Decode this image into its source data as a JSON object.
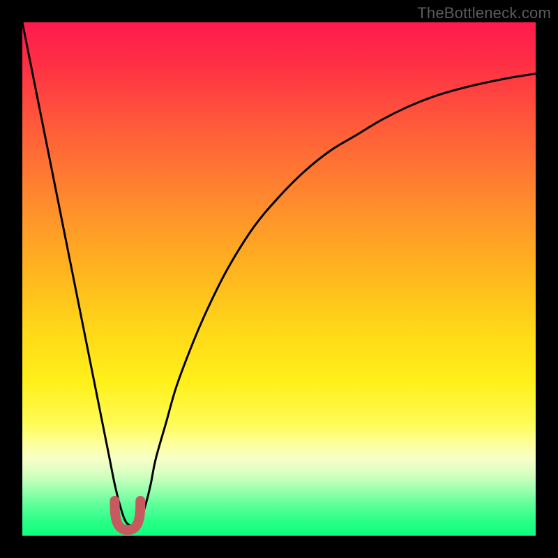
{
  "watermark": "TheBottleneck.com",
  "chart_data": {
    "type": "line",
    "title": "",
    "xlabel": "",
    "ylabel": "",
    "xlim": [
      0,
      100
    ],
    "ylim": [
      0,
      100
    ],
    "grid": false,
    "series": [
      {
        "name": "bottleneck-curve",
        "x": [
          0,
          2,
          4,
          6,
          8,
          10,
          12,
          14,
          16,
          17,
          18,
          19,
          20,
          21,
          22,
          23,
          24,
          25,
          26,
          28,
          30,
          33,
          36,
          40,
          45,
          50,
          55,
          60,
          65,
          70,
          75,
          80,
          85,
          90,
          95,
          100
        ],
        "y": [
          100,
          90,
          80,
          70,
          60,
          50,
          40,
          30,
          20,
          15,
          10,
          6,
          3,
          2,
          2,
          3,
          6,
          10,
          15,
          22,
          29,
          37,
          44,
          52,
          60,
          66,
          71,
          75,
          78,
          81,
          83.5,
          85.5,
          87,
          88.2,
          89.2,
          90
        ],
        "color": "#000000"
      }
    ],
    "marker": {
      "name": "optimal-point-marker",
      "x_range": [
        18,
        23
      ],
      "color": "#c65a5f"
    }
  }
}
